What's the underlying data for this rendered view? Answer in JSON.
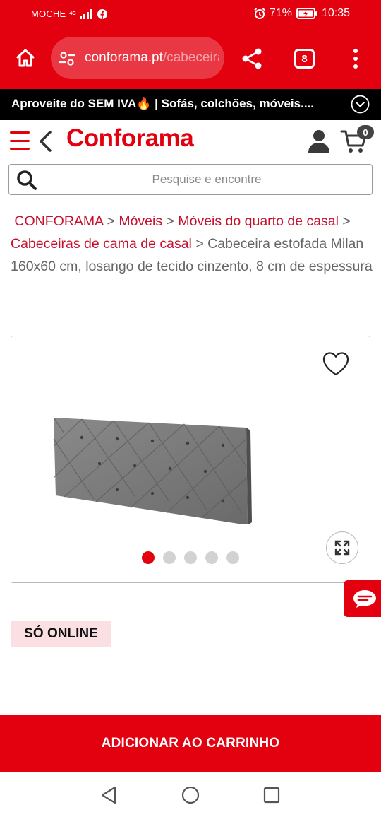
{
  "status_bar": {
    "carrier": "MOCHE",
    "network": "4G",
    "battery": "71%",
    "time": "10:35"
  },
  "browser": {
    "url_domain": "conforama.pt",
    "url_path": "/cabeceira",
    "tab_count": "8"
  },
  "promo": {
    "text": "Aproveite do SEM IVA🔥 | Sofás, colchões, móveis...."
  },
  "header": {
    "logo": "Conforama",
    "cart_count": "0"
  },
  "search": {
    "placeholder": "Pesquise e encontre"
  },
  "breadcrumb": {
    "items": [
      {
        "label": "CONFORAMA"
      },
      {
        "label": "Móveis"
      },
      {
        "label": "Móveis do quarto de casal"
      },
      {
        "label": "Cabeceiras de cama de casal"
      }
    ],
    "separator": ">",
    "current": "Cabeceira estofada Milan 160x60 cm, losango de tecido cinzento, 8 cm de espessura"
  },
  "gallery": {
    "image_count": 5,
    "active_index": 0
  },
  "badge": {
    "label": "SÓ ONLINE"
  },
  "cta": {
    "add_to_cart": "ADICIONAR AO CARRINHO"
  },
  "colors": {
    "brand_red": "#e3000f",
    "link_red": "#c8102e",
    "badge_bg": "#fbe0e3"
  },
  "icons": [
    "home-icon",
    "site-settings-icon",
    "share-icon",
    "tabs-icon",
    "more-vert-icon",
    "chevron-down-icon",
    "hamburger-icon",
    "back-chevron-icon",
    "account-icon",
    "cart-icon",
    "search-icon",
    "heart-icon",
    "expand-icon",
    "chat-icon"
  ]
}
